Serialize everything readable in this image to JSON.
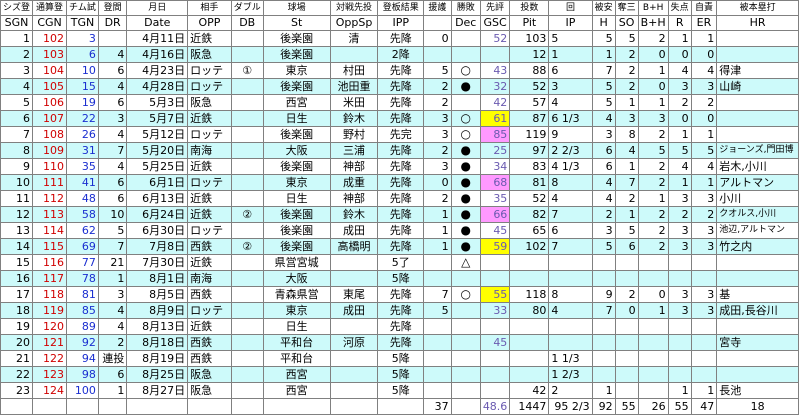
{
  "header_jp": [
    "シズ登",
    "通算登",
    "チム試",
    "登間",
    "月日",
    "相手",
    "ダブル",
    "球場",
    "対戦先投",
    "登板結果",
    "援護",
    "勝敗",
    "先評",
    "投数",
    "回",
    "被安",
    "奪三",
    "B+H",
    "失点",
    "自責",
    "被本塁打"
  ],
  "header_en": [
    "SGN",
    "CGN",
    "TGN",
    "DR",
    "Date",
    "OPP",
    "DB",
    "St",
    "OppSp",
    "IPP",
    "",
    "Dec",
    "GSC",
    "Pit",
    "IP",
    "H",
    "SO",
    "B+H",
    "R",
    "ER",
    "HR"
  ],
  "rows": [
    {
      "sgn": "1",
      "cgn": "102",
      "tgn": "3",
      "dr": "",
      "date": "4月11日",
      "opp": "近鉄",
      "db": "",
      "st": "後楽園",
      "oppsp": "清",
      "ipp": "先降",
      "run": "0",
      "dec": "",
      "gsc": "52",
      "pit": "103",
      "ip": "5",
      "h": "5",
      "so": "5",
      "bh": "2",
      "r": "1",
      "er": "1",
      "hr": ""
    },
    {
      "sgn": "2",
      "cgn": "103",
      "tgn": "6",
      "dr": "4",
      "date": "4月16日",
      "opp": "阪急",
      "db": "",
      "st": "後楽園",
      "oppsp": "",
      "ipp": "2降",
      "run": "",
      "dec": "",
      "gsc": "",
      "pit": "12",
      "ip": "1",
      "h": "1",
      "so": "2",
      "bh": "0",
      "r": "0",
      "er": "0",
      "hr": ""
    },
    {
      "sgn": "3",
      "cgn": "104",
      "tgn": "10",
      "dr": "6",
      "date": "4月23日",
      "opp": "ロッテ",
      "db": "①",
      "st": "東京",
      "oppsp": "村田",
      "ipp": "先降",
      "run": "5",
      "dec": "○",
      "gsc": "43",
      "pit": "88",
      "ip": "6",
      "h": "7",
      "so": "2",
      "bh": "1",
      "r": "4",
      "er": "4",
      "hr": "得津"
    },
    {
      "sgn": "4",
      "cgn": "105",
      "tgn": "15",
      "dr": "4",
      "date": "4月28日",
      "opp": "ロッテ",
      "db": "",
      "st": "後楽園",
      "oppsp": "池田重",
      "ipp": "先降",
      "run": "2",
      "dec": "●",
      "gsc": "32",
      "pit": "52",
      "ip": "3",
      "h": "5",
      "so": "2",
      "bh": "0",
      "r": "3",
      "er": "3",
      "hr": "山崎"
    },
    {
      "sgn": "5",
      "cgn": "106",
      "tgn": "19",
      "dr": "6",
      "date": "5月3日",
      "opp": "阪急",
      "db": "",
      "st": "西宮",
      "oppsp": "米田",
      "ipp": "先降",
      "run": "2",
      "dec": "",
      "gsc": "42",
      "pit": "57",
      "ip": "4",
      "h": "5",
      "so": "1",
      "bh": "1",
      "r": "2",
      "er": "2",
      "hr": ""
    },
    {
      "sgn": "6",
      "cgn": "107",
      "tgn": "22",
      "dr": "3",
      "date": "5月7日",
      "opp": "近鉄",
      "db": "",
      "st": "日生",
      "oppsp": "鈴木",
      "ipp": "先降",
      "run": "3",
      "dec": "○",
      "gsc": "61",
      "pit": "87",
      "ip": "6 1/3",
      "h": "4",
      "so": "3",
      "bh": "3",
      "r": "0",
      "er": "0",
      "hr": ""
    },
    {
      "sgn": "7",
      "cgn": "108",
      "tgn": "26",
      "dr": "4",
      "date": "5月12日",
      "opp": "ロッテ",
      "db": "",
      "st": "後楽園",
      "oppsp": "野村",
      "ipp": "先完",
      "run": "3",
      "dec": "○",
      "gsc": "85",
      "pit": "119",
      "ip": "9",
      "h": "3",
      "so": "8",
      "bh": "2",
      "r": "1",
      "er": "1",
      "hr": ""
    },
    {
      "sgn": "8",
      "cgn": "109",
      "tgn": "31",
      "dr": "7",
      "date": "5月20日",
      "opp": "南海",
      "db": "",
      "st": "大阪",
      "oppsp": "三浦",
      "ipp": "先降",
      "run": "2",
      "dec": "●",
      "gsc": "25",
      "pit": "97",
      "ip": "2 2/3",
      "h": "6",
      "so": "4",
      "bh": "5",
      "r": "5",
      "er": "5",
      "hr": "ジョーンズ,門田博"
    },
    {
      "sgn": "9",
      "cgn": "110",
      "tgn": "35",
      "dr": "4",
      "date": "5月25日",
      "opp": "近鉄",
      "db": "",
      "st": "後楽園",
      "oppsp": "神部",
      "ipp": "先降",
      "run": "3",
      "dec": "●",
      "gsc": "34",
      "pit": "83",
      "ip": "4 1/3",
      "h": "6",
      "so": "1",
      "bh": "2",
      "r": "4",
      "er": "4",
      "hr": "岩木,小川"
    },
    {
      "sgn": "10",
      "cgn": "111",
      "tgn": "41",
      "dr": "6",
      "date": "6月1日",
      "opp": "ロッテ",
      "db": "",
      "st": "東京",
      "oppsp": "成重",
      "ipp": "先降",
      "run": "0",
      "dec": "●",
      "gsc": "68",
      "pit": "81",
      "ip": "8",
      "h": "4",
      "so": "7",
      "bh": "2",
      "r": "1",
      "er": "1",
      "hr": "アルトマン"
    },
    {
      "sgn": "11",
      "cgn": "112",
      "tgn": "48",
      "dr": "6",
      "date": "6月13日",
      "opp": "近鉄",
      "db": "",
      "st": "日生",
      "oppsp": "神部",
      "ipp": "先降",
      "run": "2",
      "dec": "●",
      "gsc": "35",
      "pit": "52",
      "ip": "4",
      "h": "4",
      "so": "2",
      "bh": "1",
      "r": "3",
      "er": "3",
      "hr": "小川"
    },
    {
      "sgn": "12",
      "cgn": "113",
      "tgn": "58",
      "dr": "10",
      "date": "6月24日",
      "opp": "近鉄",
      "db": "②",
      "st": "後楽園",
      "oppsp": "鈴木",
      "ipp": "先降",
      "run": "1",
      "dec": "●",
      "gsc": "66",
      "pit": "82",
      "ip": "7",
      "h": "2",
      "so": "1",
      "bh": "2",
      "r": "2",
      "er": "2",
      "hr": "クオルス,小川"
    },
    {
      "sgn": "13",
      "cgn": "114",
      "tgn": "62",
      "dr": "5",
      "date": "6月30日",
      "opp": "ロッテ",
      "db": "",
      "st": "後楽園",
      "oppsp": "成田",
      "ipp": "先降",
      "run": "1",
      "dec": "●",
      "gsc": "45",
      "pit": "65",
      "ip": "6",
      "h": "3",
      "so": "5",
      "bh": "2",
      "r": "3",
      "er": "3",
      "hr": "池辺,アルトマン"
    },
    {
      "sgn": "14",
      "cgn": "115",
      "tgn": "69",
      "dr": "7",
      "date": "7月8日",
      "opp": "西鉄",
      "db": "②",
      "st": "後楽園",
      "oppsp": "高橋明",
      "ipp": "先降",
      "run": "1",
      "dec": "●",
      "gsc": "59",
      "pit": "102",
      "ip": "7",
      "h": "5",
      "so": "6",
      "bh": "2",
      "r": "3",
      "er": "3",
      "hr": "竹之内"
    },
    {
      "sgn": "15",
      "cgn": "116",
      "tgn": "77",
      "dr": "21",
      "date": "7月30日",
      "opp": "近鉄",
      "db": "",
      "st": "県営宮城",
      "oppsp": "",
      "ipp": "5了",
      "run": "",
      "dec": "△",
      "gsc": "",
      "pit": "",
      "ip": "",
      "h": "",
      "so": "",
      "bh": "",
      "r": "",
      "er": "",
      "hr": ""
    },
    {
      "sgn": "16",
      "cgn": "117",
      "tgn": "78",
      "dr": "1",
      "date": "8月1日",
      "opp": "南海",
      "db": "",
      "st": "大阪",
      "oppsp": "",
      "ipp": "5降",
      "run": "",
      "dec": "",
      "gsc": "",
      "pit": "",
      "ip": "",
      "h": "",
      "so": "",
      "bh": "",
      "r": "",
      "er": "",
      "hr": ""
    },
    {
      "sgn": "17",
      "cgn": "118",
      "tgn": "81",
      "dr": "3",
      "date": "8月5日",
      "opp": "西鉄",
      "db": "",
      "st": "青森県営",
      "oppsp": "東尾",
      "ipp": "先降",
      "run": "7",
      "dec": "○",
      "gsc": "55",
      "pit": "118",
      "ip": "8",
      "h": "9",
      "so": "2",
      "bh": "0",
      "r": "3",
      "er": "3",
      "hr": "基"
    },
    {
      "sgn": "18",
      "cgn": "119",
      "tgn": "85",
      "dr": "4",
      "date": "8月9日",
      "opp": "ロッテ",
      "db": "",
      "st": "東京",
      "oppsp": "成田",
      "ipp": "先降",
      "run": "5",
      "dec": "",
      "gsc": "33",
      "pit": "80",
      "ip": "4",
      "h": "7",
      "so": "0",
      "bh": "1",
      "r": "3",
      "er": "3",
      "hr": "成田,長谷川"
    },
    {
      "sgn": "19",
      "cgn": "120",
      "tgn": "89",
      "dr": "4",
      "date": "8月13日",
      "opp": "近鉄",
      "db": "",
      "st": "日生",
      "oppsp": "",
      "ipp": "先降",
      "run": "",
      "dec": "",
      "gsc": "",
      "pit": "",
      "ip": "",
      "h": "",
      "so": "",
      "bh": "",
      "r": "",
      "er": "",
      "hr": ""
    },
    {
      "sgn": "20",
      "cgn": "121",
      "tgn": "92",
      "dr": "2",
      "date": "8月18日",
      "opp": "西鉄",
      "db": "",
      "st": "平和台",
      "oppsp": "河原",
      "ipp": "先降",
      "run": "",
      "dec": "",
      "gsc": "45",
      "pit": "",
      "ip": "",
      "h": "",
      "so": "",
      "bh": "",
      "r": "",
      "er": "",
      "hr": "宮寺"
    },
    {
      "sgn": "21",
      "cgn": "122",
      "tgn": "94",
      "dr": "連投",
      "date": "8月19日",
      "opp": "西鉄",
      "db": "",
      "st": "平和台",
      "oppsp": "",
      "ipp": "5降",
      "run": "",
      "dec": "",
      "gsc": "",
      "pit": "",
      "ip": "1 1/3",
      "h": "",
      "so": "",
      "bh": "",
      "r": "",
      "er": "",
      "hr": ""
    },
    {
      "sgn": "22",
      "cgn": "123",
      "tgn": "98",
      "dr": "6",
      "date": "8月25日",
      "opp": "阪急",
      "db": "",
      "st": "西宮",
      "oppsp": "",
      "ipp": "5降",
      "run": "",
      "dec": "",
      "gsc": "",
      "pit": "",
      "ip": "1 2/3",
      "h": "",
      "so": "",
      "bh": "",
      "r": "",
      "er": "",
      "hr": ""
    },
    {
      "sgn": "23",
      "cgn": "124",
      "tgn": "100",
      "dr": "1",
      "date": "8月27日",
      "opp": "阪急",
      "db": "",
      "st": "西宮",
      "oppsp": "",
      "ipp": "5降",
      "run": "",
      "dec": "",
      "gsc": "",
      "pit": "42",
      "ip": "2",
      "h": "1",
      "so": "",
      "bh": "",
      "r": "1",
      "er": "1",
      "hr": "長池"
    }
  ],
  "totals": {
    "run": "37",
    "gsc": "48.6",
    "pit": "1447",
    "ip": "95 2/3",
    "h": "92",
    "so": "55",
    "bh": "26",
    "r": "55",
    "er": "47",
    "hr": "18"
  },
  "highlights": {
    "yellow": "#ffff00",
    "pink": "#ff99ff",
    "alt_row": "#cdfafa"
  }
}
